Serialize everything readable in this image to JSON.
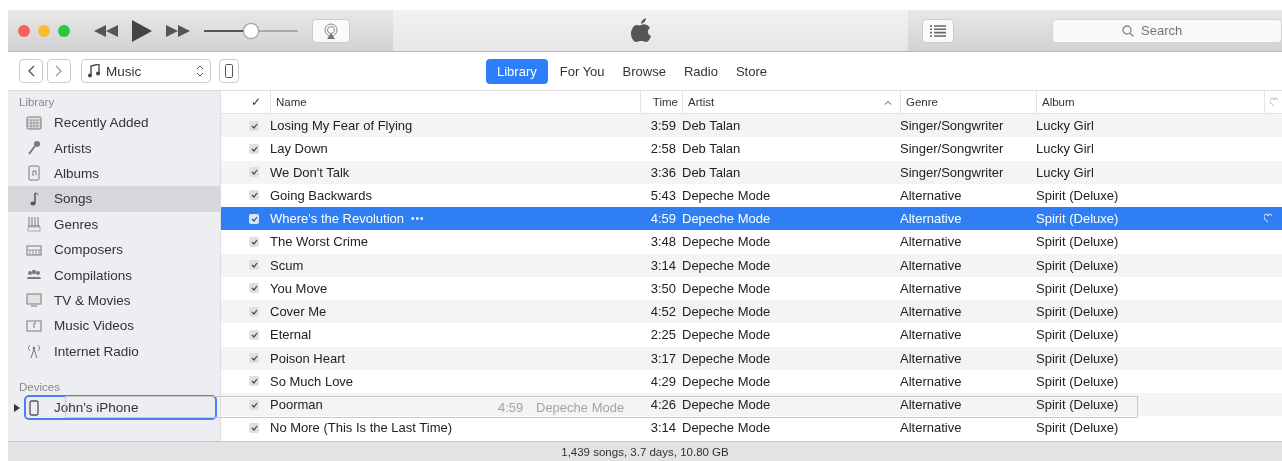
{
  "toolbar": {
    "volume": {
      "level": 0.5
    },
    "search": {
      "placeholder": "Search"
    }
  },
  "navbar": {
    "source": "Music",
    "tabs": [
      {
        "label": "Library",
        "selected": true
      },
      {
        "label": "For You",
        "selected": false
      },
      {
        "label": "Browse",
        "selected": false
      },
      {
        "label": "Radio",
        "selected": false
      },
      {
        "label": "Store",
        "selected": false
      }
    ]
  },
  "sidebar": {
    "sections": [
      {
        "title": "Library",
        "items": [
          {
            "label": "Recently Added",
            "kind": "calendar",
            "selected": false
          },
          {
            "label": "Artists",
            "kind": "mic",
            "selected": false
          },
          {
            "label": "Albums",
            "kind": "album",
            "selected": false
          },
          {
            "label": "Songs",
            "kind": "note",
            "selected": true
          },
          {
            "label": "Genres",
            "kind": "genres",
            "selected": false
          },
          {
            "label": "Composers",
            "kind": "piano",
            "selected": false
          },
          {
            "label": "Compilations",
            "kind": "people",
            "selected": false
          },
          {
            "label": "TV & Movies",
            "kind": "tv",
            "selected": false
          },
          {
            "label": "Music Videos",
            "kind": "video",
            "selected": false
          },
          {
            "label": "Internet Radio",
            "kind": "antenna",
            "selected": false
          }
        ]
      },
      {
        "title": "Devices",
        "items": [
          {
            "label": "John's iPhone",
            "kind": "phone",
            "selected": false,
            "drop_target": true
          }
        ]
      }
    ]
  },
  "table": {
    "columns": {
      "check": "✓",
      "name": "Name",
      "time": "Time",
      "artist": "Artist",
      "genre": "Genre",
      "album": "Album"
    },
    "rows": [
      {
        "checked": true,
        "name": "Losing My Fear of Flying",
        "time": "3:59",
        "artist": "Deb Talan",
        "genre": "Singer/Songwriter",
        "album": "Lucky Girl",
        "selected": false
      },
      {
        "checked": true,
        "name": "Lay Down",
        "time": "2:58",
        "artist": "Deb Talan",
        "genre": "Singer/Songwriter",
        "album": "Lucky Girl",
        "selected": false
      },
      {
        "checked": true,
        "name": "We Don't Talk",
        "time": "3:36",
        "artist": "Deb Talan",
        "genre": "Singer/Songwriter",
        "album": "Lucky Girl",
        "selected": false
      },
      {
        "checked": true,
        "name": "Going Backwards",
        "time": "5:43",
        "artist": "Depeche Mode",
        "genre": "Alternative",
        "album": "Spirit (Deluxe)",
        "selected": false
      },
      {
        "checked": true,
        "name": "Where's the Revolution",
        "more": "•••",
        "time": "4:59",
        "artist": "Depeche Mode",
        "genre": "Alternative",
        "album": "Spirit (Deluxe)",
        "selected": true
      },
      {
        "checked": true,
        "name": "The Worst Crime",
        "time": "3:48",
        "artist": "Depeche Mode",
        "genre": "Alternative",
        "album": "Spirit (Deluxe)",
        "selected": false
      },
      {
        "checked": true,
        "name": "Scum",
        "time": "3:14",
        "artist": "Depeche Mode",
        "genre": "Alternative",
        "album": "Spirit (Deluxe)",
        "selected": false
      },
      {
        "checked": true,
        "name": "You Move",
        "time": "3:50",
        "artist": "Depeche Mode",
        "genre": "Alternative",
        "album": "Spirit (Deluxe)",
        "selected": false
      },
      {
        "checked": true,
        "name": "Cover Me",
        "time": "4:52",
        "artist": "Depeche Mode",
        "genre": "Alternative",
        "album": "Spirit (Deluxe)",
        "selected": false
      },
      {
        "checked": true,
        "name": "Eternal",
        "time": "2:25",
        "artist": "Depeche Mode",
        "genre": "Alternative",
        "album": "Spirit (Deluxe)",
        "selected": false
      },
      {
        "checked": true,
        "name": "Poison Heart",
        "time": "3:17",
        "artist": "Depeche Mode",
        "genre": "Alternative",
        "album": "Spirit (Deluxe)",
        "selected": false
      },
      {
        "checked": true,
        "name": "So Much Love",
        "time": "4:29",
        "artist": "Depeche Mode",
        "genre": "Alternative",
        "album": "Spirit (Deluxe)",
        "selected": false
      },
      {
        "checked": true,
        "name": "Poorman",
        "time": "4:26",
        "artist": "Depeche Mode",
        "genre": "Alternative",
        "album": "Spirit (Deluxe)",
        "selected": false
      },
      {
        "checked": true,
        "name": "No More (This Is the Last Time)",
        "time": "3:14",
        "artist": "Depeche Mode",
        "genre": "Alternative",
        "album": "Spirit (Deluxe)",
        "selected": false
      }
    ]
  },
  "drag_ghost": {
    "time": "4:59",
    "artist": "Depeche Mode"
  },
  "status_bar": "1,439 songs, 3.7 days, 10.80 GB"
}
